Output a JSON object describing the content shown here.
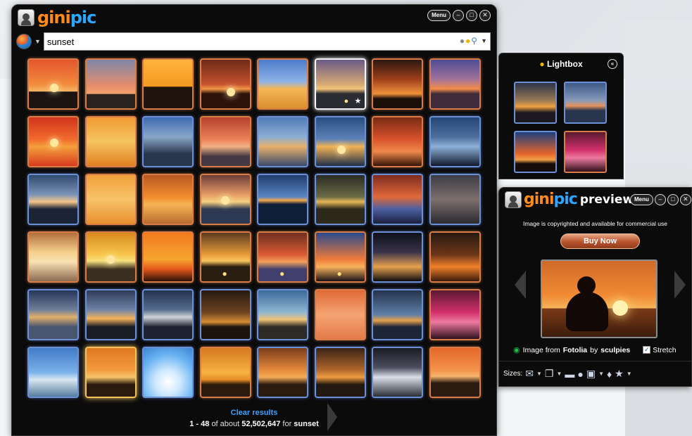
{
  "app": {
    "logo_a": "gini",
    "logo_b": "pic",
    "menu_label": "Menu",
    "controls": [
      "–",
      "□",
      "✕"
    ]
  },
  "search": {
    "value": "sunset",
    "icons": [
      "camera-icon",
      "bulb-icon",
      "magnifier-icon",
      "dropdown-icon"
    ]
  },
  "results": {
    "thumbnails": [
      {
        "g": "linear-gradient(180deg,#e4562e,#f28a3b 50%,#f5b765 65%,#1b1411 66%)",
        "s": [
          30,
          34
        ],
        "v": "orange"
      },
      {
        "g": "linear-gradient(180deg,#7d86a8,#e88e6c 55%,#f3a46c 70%,#2b2320 71%)",
        "s": [],
        "v": "orange"
      },
      {
        "g": "linear-gradient(180deg,#ffb33a,#f39a22 55%,#20140c 56%)",
        "s": [],
        "v": "orange"
      },
      {
        "g": "linear-gradient(180deg,#6e2a18,#c4512d 50%,#f29344 60%,#2c120a 70%)",
        "s": [
          36,
          40
        ],
        "v": "orange"
      },
      {
        "g": "linear-gradient(180deg,#4c7cc9,#8db3e8 45%,#f7b657 60%,#d8902e)",
        "s": [],
        "v": "orange"
      },
      {
        "g": "linear-gradient(180deg,#6b5a86,#d6a874 50%,#f4c57a 60%,#2b2b33 70%)",
        "s": [],
        "v": "sel",
        "ov": true
      },
      {
        "g": "linear-gradient(180deg,#2b1710,#9d3f1b 40%,#f0903a 70%,#1c0f0a 80%)",
        "s": [],
        "v": "orange"
      },
      {
        "g": "linear-gradient(180deg,#4d4c94,#a1729b 40%,#f38c49 60%,#3f2b39 70%)",
        "s": [],
        "v": "orange"
      },
      {
        "g": "linear-gradient(180deg,#d1341d,#f26a2c 45%,#f4a03b 60%,#d73a20)",
        "s": [
          30,
          30
        ],
        "v": "orange"
      },
      {
        "g": "linear-gradient(180deg,#f19a32,#f5c460 50%,#e08021)",
        "s": [],
        "v": "orange"
      },
      {
        "g": "linear-gradient(180deg,#3d6ab0,#89a7c9 40%,#29374e 75%)",
        "s": [],
        "v": "blue"
      },
      {
        "g": "linear-gradient(180deg,#b4412c,#ec8158 45%,#f0b183 60%,#463944 80%)",
        "s": [],
        "v": "orange"
      },
      {
        "g": "linear-gradient(180deg,#4f7bb7,#8caed4 40%,#e7b06b 60%,#394a6b)",
        "s": [],
        "v": "blue"
      },
      {
        "g": "linear-gradient(180deg,#294e82,#5e82b7 45%,#f2b255 60%,#1f2f4a)",
        "s": [
          30,
          40
        ],
        "v": "blue"
      },
      {
        "g": "linear-gradient(180deg,#7a2b15,#d8522c 45%,#f0894a 70%,#361508)",
        "s": [],
        "v": "orange"
      },
      {
        "g": "linear-gradient(180deg,#244677,#4d6e9c 40%,#8db0d8 60%,#10182c)",
        "s": [],
        "v": "blue"
      },
      {
        "g": "linear-gradient(180deg,#30496f,#7a93b5 40%,#f6c58a 55%,#1b2435 70%)",
        "s": [],
        "v": "blue"
      },
      {
        "g": "linear-gradient(180deg,#f2a03b,#f7c26a 50%,#e8912e)",
        "s": [],
        "v": "orange"
      },
      {
        "g": "linear-gradient(180deg,#b85a21,#f18c2e 45%,#f7b454 60%,#b86c2f)",
        "s": [],
        "v": "orange"
      },
      {
        "g": "linear-gradient(180deg,#6e3d39,#e49a64 40%,#f7cf80 55%,#2d3852 70%)",
        "s": [
          28,
          30
        ],
        "v": "orange"
      },
      {
        "g": "linear-gradient(180deg,#1f3d6d,#5a86c2 45%,#f4a94d 52%,#0f1f37 60%)",
        "s": [],
        "v": "blue"
      },
      {
        "g": "linear-gradient(180deg,#2a2b23,#6b6c46 45%,#e6b856 55%,#2d2a1c 70%)",
        "s": [],
        "v": "blue"
      },
      {
        "g": "linear-gradient(180deg,#7e2c1f,#e0693a 45%,#4b5fa0 70%,#1b1f3d)",
        "s": [],
        "v": "blue"
      },
      {
        "g": "linear-gradient(180deg,#3c3c46,#7e6f6c 50%,#2a2a30)",
        "s": [],
        "v": "blue"
      },
      {
        "g": "linear-gradient(180deg,#b1703f,#f5d08b 40%,#f7e1b1 60%,#8c6b52)",
        "s": [],
        "v": "orange"
      },
      {
        "g": "linear-gradient(180deg,#d78a1e,#f8c54b 45%,#f8e07c 58%,#3a2f20 75%)",
        "s": [
          28,
          32
        ],
        "v": "orange"
      },
      {
        "g": "linear-gradient(180deg,#f27a1e,#f7a430 55%,#e4561b 75%,#2a1208)",
        "s": [],
        "v": "orange"
      },
      {
        "g": "linear-gradient(180deg,#5c3b1f,#e89b39 45%,#f8c45c 58%,#2a1d12 70%)",
        "s": [],
        "v": "orange",
        "ov2": true
      },
      {
        "g": "linear-gradient(180deg,#6e2f21,#da5a33 45%,#f3a15a 60%,#413f6d 75%)",
        "s": [],
        "v": "orange",
        "ov2": true
      },
      {
        "g": "linear-gradient(180deg,#284a8c,#f07b3a 55%,#f7b25b 70%,#191319)",
        "s": [],
        "v": "orange",
        "ov2": true
      },
      {
        "g": "linear-gradient(180deg,#0d1018,#39334a 40%,#e6a04e 70%,#0c0b0e)",
        "s": [],
        "v": "blue"
      },
      {
        "g": "linear-gradient(180deg,#281911,#6c3518 45%,#f0812b 70%,#3a1b0b)",
        "s": [],
        "v": "orange"
      },
      {
        "g": "linear-gradient(180deg,#27375a,#6f7e98 40%,#e1b06b 55%,#4a5570 75%)",
        "s": [],
        "v": "blue"
      },
      {
        "g": "linear-gradient(180deg,#2f3b57,#6e84a6 40%,#f7b35a 58%,#1a1d25 75%)",
        "s": [],
        "v": "blue"
      },
      {
        "g": "linear-gradient(180deg,#22324f,#556d8e 40%,#cfd3d8 55%,#1d2230 75%)",
        "s": [],
        "v": "blue"
      },
      {
        "g": "linear-gradient(180deg,#26190f,#6e4321 45%,#d68d35 65%,#1c130c 75%)",
        "s": [],
        "v": "blue"
      },
      {
        "g": "linear-gradient(180deg,#3a6b99,#8fb6d2 45%,#f2c478 60%,#2e2b25 75%)",
        "s": [],
        "v": "blue"
      },
      {
        "g": "linear-gradient(180deg,#e06a37,#f4a472 50%,#e47a49)",
        "s": [],
        "v": "orange"
      },
      {
        "g": "linear-gradient(180deg,#24334d,#5e7fa7 50%,#e5a14c 62%,#1d2639 75%)",
        "s": [],
        "v": "blue"
      },
      {
        "g": "linear-gradient(180deg,#5a182f,#d2306b 45%,#ee7aa0 65%,#2f0f1c)",
        "s": [],
        "v": "orange"
      },
      {
        "g": "linear-gradient(180deg,#427bc8,#7ab2e9 50%,#d9e7f2 65%,#567c9d)",
        "s": [],
        "v": "blue"
      },
      {
        "g": "linear-gradient(180deg,#e07822,#f39a3d 45%,#f7c36a 60%,#2a1a0f 75%)",
        "s": [],
        "v": "gold"
      },
      {
        "g": "radial-gradient(circle at 50% 70%,#ffffff,#cfe8ff 30%,#6bb4f2 65%,#3b84d2)",
        "s": [],
        "v": "blue"
      },
      {
        "g": "linear-gradient(180deg,#d4791f,#f7b341 50%,#e58f26 65%,#2c1a0a 75%)",
        "s": [],
        "v": "orange"
      },
      {
        "g": "linear-gradient(180deg,#7c3d1c,#e48a3a 45%,#f4ac55 60%,#2a1b10 75%)",
        "s": [],
        "v": "blue"
      },
      {
        "g": "linear-gradient(180deg,#3b2315,#b0672b 45%,#f09c3f 60%,#241910 75%)",
        "s": [],
        "v": "blue"
      },
      {
        "g": "linear-gradient(180deg,#1a1a22,#4c4d5e 40%,#d9dfe8 60%,#2a2d35)",
        "s": [],
        "v": "blue"
      },
      {
        "g": "linear-gradient(180deg,#e4672a,#f4934c 45%,#f7b46c 58%,#2b1a10 72%)",
        "s": [],
        "v": "orange"
      }
    ],
    "clear_label": "Clear results",
    "range": "1 - 48",
    "of_about": "of about",
    "total": "52,502,647",
    "for_word": "for",
    "query": "sunset"
  },
  "lightbox": {
    "title": "Lightbox",
    "close_label": "«",
    "thumbnails": [
      {
        "g": "linear-gradient(180deg,#2b3348,#9b7a55 45%,#f0a240 60%,#1c1a20 75%)",
        "o": false
      },
      {
        "g": "linear-gradient(180deg,#3d5a8a,#8a9bb8 45%,#e5945c 58%,#28354c 70%)",
        "o": false
      },
      {
        "g": "linear-gradient(180deg,#1f3f7c,#e4652a 55%,#f2a046 70%,#150d0a 80%)",
        "o": false
      },
      {
        "g": "linear-gradient(180deg,#5a182f,#d2306b 45%,#ee7aa0 65%,#2f0f1c)",
        "o": true
      }
    ]
  },
  "preview": {
    "logo_a": "gini",
    "logo_b": "pic",
    "word": "preview",
    "menu_label": "Menu",
    "copyright": "Image is copyrighted and available for commercial use",
    "buy_label": "Buy Now",
    "source_prefix": "Image from",
    "source_site": "Fotolia",
    "by_word": "by",
    "author": "sculpies",
    "stretch_label": "Stretch",
    "sizes_label": "Sizes:"
  },
  "colors": {
    "accent_orange": "#ff8a1a",
    "accent_blue": "#2aa7ff",
    "link_blue": "#3ba0ff"
  }
}
